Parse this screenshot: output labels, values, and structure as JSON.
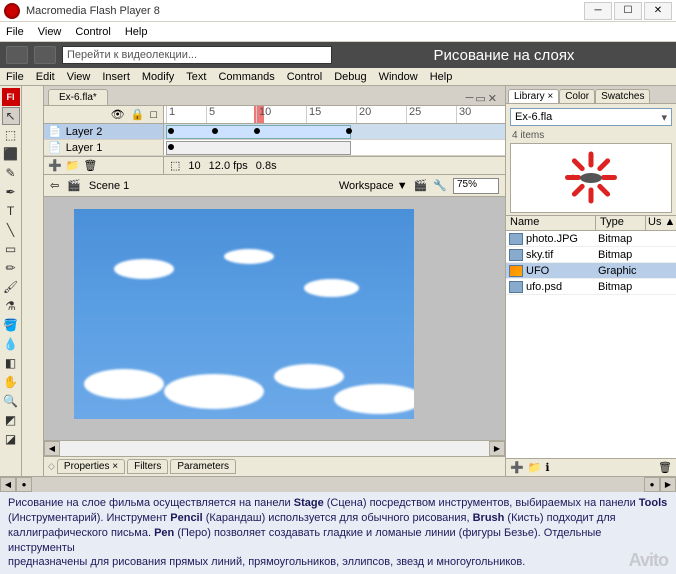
{
  "titlebar": {
    "title": "Macromedia Flash Player 8"
  },
  "player_menu": [
    "File",
    "View",
    "Control",
    "Help"
  ],
  "dark_bar": {
    "search_placeholder": "Перейти к видеолекции...",
    "title": "Рисование на слоях"
  },
  "flash_menu": [
    "File",
    "Edit",
    "View",
    "Insert",
    "Modify",
    "Text",
    "Commands",
    "Control",
    "Debug",
    "Window",
    "Help"
  ],
  "doc_tab": "Ex-6.fla*",
  "timeline": {
    "layers": [
      {
        "name": "Layer 2",
        "selected": true
      },
      {
        "name": "Layer 1",
        "selected": false
      }
    ],
    "ruler": [
      "1",
      "5",
      "10",
      "15",
      "20",
      "25",
      "30"
    ],
    "footer": {
      "frame": "10",
      "fps": "12.0 fps",
      "time": "0.8s"
    }
  },
  "scene_bar": {
    "scene": "Scene 1",
    "workspace": "Workspace ▼",
    "zoom": "75%"
  },
  "props_tabs": [
    "Properties ×",
    "Filters",
    "Parameters"
  ],
  "library": {
    "tabs": [
      "Library ×",
      "Color",
      "Swatches"
    ],
    "file": "Ex-6.fla",
    "count": "4 items",
    "columns": {
      "name": "Name",
      "type": "Type",
      "use": "Us ▲"
    },
    "items": [
      {
        "name": "photo.JPG",
        "type": "Bitmap",
        "sel": false,
        "icon": "bmp"
      },
      {
        "name": "sky.tif",
        "type": "Bitmap",
        "sel": false,
        "icon": "bmp"
      },
      {
        "name": "UFO",
        "type": "Graphic",
        "sel": true,
        "icon": "gfx"
      },
      {
        "name": "ufo.psd",
        "type": "Bitmap",
        "sel": false,
        "icon": "bmp"
      }
    ]
  },
  "page_text": {
    "l1a": "Рисование на слое фильма  осуществляется на панели ",
    "l1b": "Stage",
    "l1c": "  (Сцена) посредством инструментов, выбираемых на панели ",
    "l1d": "Tools",
    "l2a": "(Инструментарий). Инструмент ",
    "l2b": "Pencil",
    "l2c": "  (Карандаш) используется для  обычного рисования, ",
    "l2d": "Brush",
    "l2e": "  (Кисть) подходит для",
    "l3a": "каллиграфического письма.  ",
    "l3b": "Pen",
    "l3c": " (Перо) позволяет создавать гладкие и ломаные линии (фигуры Безье).  Отдельные инструменты",
    "l4": "предназначены для рисования  прямых линий, прямоугольников, эллипсов,  звезд и многоугольников."
  },
  "watermark": "Avito"
}
